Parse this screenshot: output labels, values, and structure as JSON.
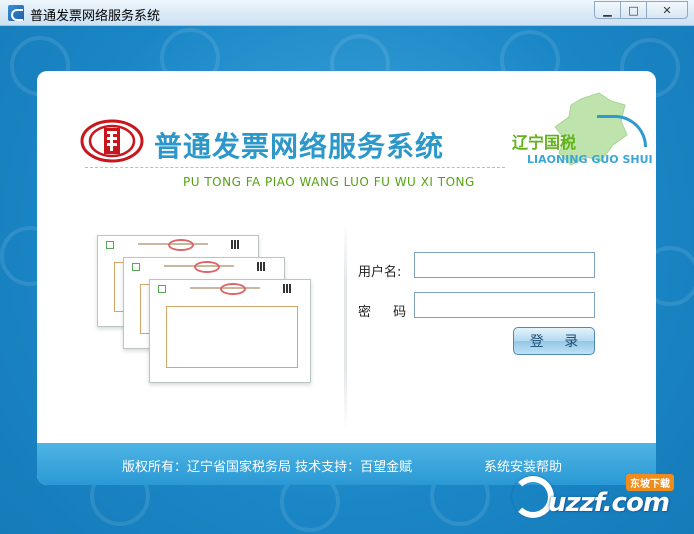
{
  "window": {
    "title": "普通发票网络服务系统",
    "minimize_glyph": "▁",
    "maximize_glyph": "□",
    "close_glyph": "✕"
  },
  "header": {
    "main_title": "普通发票网络服务系统",
    "pinyin": "PU TONG FA PIAO WANG LUO FU WU XI TONG",
    "province_name": "辽宁国税",
    "province_en": "LIAONING GUO SHUI"
  },
  "form": {
    "username_label": "用户名:",
    "password_label": "密 码:",
    "username_value": "",
    "password_value": "",
    "login_button": "登 录"
  },
  "footer": {
    "copyright": "版权所有：辽宁省国家税务局   技术支持：百望金赋",
    "help_link": "系统安装帮助"
  },
  "watermark": {
    "text": "uzzf.com",
    "badge": "东坡下载"
  },
  "colors": {
    "title_blue": "#2c97c9",
    "pinyin_green": "#54a30f",
    "footer_blue": "#2a98d4",
    "background_blue": "#1a86c6"
  },
  "icons": [
    "app-icon",
    "tax-emblem-icon",
    "liaoning-map-icon",
    "invoice-illustration"
  ]
}
